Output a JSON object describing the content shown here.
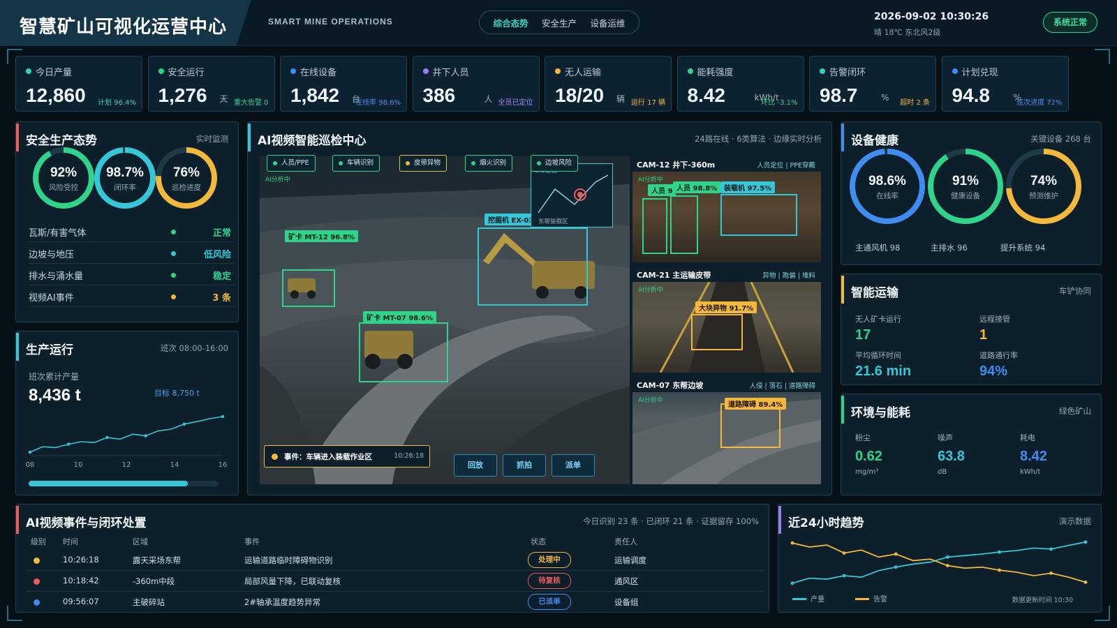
{
  "header": {
    "title": "智慧矿山可视化运营中心",
    "subtitle": "SMART MINE OPERATIONS",
    "tabs": [
      "综合态势",
      "安全生产",
      "设备运维"
    ],
    "datetime": "2026-09-02  10:30:26",
    "weather": "晴 18℃ 东北风2级",
    "status": "系统正常"
  },
  "kpis": [
    {
      "label": "今日产量",
      "value": "12,860",
      "unit": "",
      "note": "计划 96.4%",
      "color": "#33d1c4",
      "note_color": "#33d1c4"
    },
    {
      "label": "安全运行",
      "value": "1,276",
      "unit": "天",
      "note": "重大告警 0",
      "color": "#2fd48b",
      "note_color": "#2fd48b"
    },
    {
      "label": "在线设备",
      "value": "1,842",
      "unit": "台",
      "note": "在线率 98.6%",
      "color": "#3f8df0",
      "note_color": "#3f8df0"
    },
    {
      "label": "井下人员",
      "value": "386",
      "unit": "人",
      "note": "全员已定位",
      "color": "#9a7ef0",
      "note_color": "#a78bff"
    },
    {
      "label": "无人运输",
      "value": "18/20",
      "unit": "辆",
      "note": "运行 17 辆",
      "color": "#f5b93a",
      "note_color": "#f5b93a"
    },
    {
      "label": "能耗强度",
      "value": "8.42",
      "unit": "kWh/t",
      "note": "环比 -3.1%",
      "color": "#2fd48b",
      "note_color": "#2fd48b"
    },
    {
      "label": "告警闭环",
      "value": "98.7",
      "unit": "%",
      "note": "超时 2 条",
      "color": "#33d1c4",
      "note_color": "#f5b93a"
    },
    {
      "label": "计划兑现",
      "value": "94.8",
      "unit": "%",
      "note": "班次进度 72%",
      "color": "#3f8df0",
      "note_color": "#3f8df0"
    }
  ],
  "safety": {
    "title": "安全生产态势",
    "note": "实时监测",
    "rings": [
      {
        "pct": "92%",
        "cap": "风险受控",
        "value": 0.92,
        "color": "#2fd48b"
      },
      {
        "pct": "98.7%",
        "cap": "闭环率",
        "value": 0.987,
        "color": "#33c7d8"
      },
      {
        "pct": "76%",
        "cap": "巡检进度",
        "value": 0.76,
        "color": "#f5b93a"
      }
    ],
    "rows": [
      {
        "name": "瓦斯/有害气体",
        "status": "正常",
        "color": "#2fd48b"
      },
      {
        "name": "边坡与地压",
        "status": "低风险",
        "color": "#33c7d8"
      },
      {
        "name": "排水与涌水量",
        "status": "稳定",
        "color": "#2fd48b"
      },
      {
        "name": "视频AI事件",
        "status": "3 条",
        "color": "#f5b93a"
      }
    ]
  },
  "production": {
    "title": "生产运行",
    "note": "班次 08:00-16:00",
    "cum_label": "班次累计产量",
    "cum_value": "8,436 t",
    "target": "目标 8,750 t",
    "x_ticks": [
      "08",
      "10",
      "12",
      "14",
      "16"
    ],
    "trend": [
      0.05,
      0.18,
      0.16,
      0.24,
      0.3,
      0.28,
      0.4,
      0.36,
      0.48,
      0.44,
      0.56,
      0.6,
      0.72,
      0.78,
      0.85,
      0.9
    ],
    "progress": 0.84
  },
  "video": {
    "title": "AI视频智能巡检中心",
    "note": "24路在线 · 6类算法 · 边缘实时分析",
    "filters": [
      {
        "label": "人员/PPE",
        "color": "#2fd48b"
      },
      {
        "label": "车辆识别",
        "color": "#2fd48b"
      },
      {
        "label": "皮带异物",
        "color": "#f5b93a"
      },
      {
        "label": "烟火识别",
        "color": "#2fd48b"
      },
      {
        "label": "边坡风险",
        "color": "#2fd48b"
      }
    ],
    "main_tags": [
      {
        "text": "矿卡 MT-12  96.8%"
      },
      {
        "text": "挖掘机 EX-03"
      },
      {
        "text": "矿卡 MT-07  98.6%"
      }
    ],
    "ai_label": "AI分析中",
    "gis_label": "GIS定位",
    "gis_area": "东帮装载区",
    "event_text": "事件：车辆进入装载作业区",
    "event_time": "10:26:18",
    "controls": [
      "回放",
      "抓拍",
      "派单"
    ],
    "side": [
      {
        "title": "CAM-12  井下-360m",
        "note": "人员定位 | PPE穿戴",
        "tags": [
          "人员 98.8%",
          "装载机 97.5%",
          "人员 9"
        ]
      },
      {
        "title": "CAM-21  主运输皮带",
        "note": "异物 | 跑偏 | 堆料",
        "tags": [
          "大块异物  91.7%"
        ]
      },
      {
        "title": "CAM-07  东帮边坡",
        "note": "人侵 | 落石 | 道路障碍",
        "tags": [
          "道路障碍  89.4%"
        ]
      }
    ]
  },
  "health": {
    "title": "设备健康",
    "note": "关键设备 268 台",
    "rings": [
      {
        "pct": "98.6%",
        "cap": "在线率",
        "value": 0.986,
        "color": "#3f8df0"
      },
      {
        "pct": "91%",
        "cap": "健康设备",
        "value": 0.91,
        "color": "#2fd48b"
      },
      {
        "pct": "74%",
        "cap": "预测维护",
        "value": 0.74,
        "color": "#f5b93a"
      }
    ],
    "items": [
      "主通风机  98",
      "主排水  96",
      "提升系统  94"
    ]
  },
  "transport": {
    "title": "智能运输",
    "note": "车铲协同",
    "m1_label": "无人矿卡运行",
    "m1_value": "17",
    "m2_label": "远程接管",
    "m2_value": "1",
    "m3_label": "平均循环时间",
    "m3_value": "21.6 min",
    "m4_label": "道路通行率",
    "m4_value": "94%"
  },
  "env": {
    "title": "环境与能耗",
    "note": "绿色矿山",
    "metrics": [
      {
        "label": "粉尘",
        "value": "0.62",
        "unit": "mg/m³",
        "color": "#2fd48b"
      },
      {
        "label": "噪声",
        "value": "63.8",
        "unit": "dB",
        "color": "#33c7d8"
      },
      {
        "label": "耗电",
        "value": "8.42",
        "unit": "kWh/t",
        "color": "#3f8df0"
      }
    ]
  },
  "events": {
    "title": "AI视频事件与闭环处置",
    "note": "今日识别 23 条 · 已闭环 21 条 · 证据留存 100%",
    "headers": [
      "级别",
      "时间",
      "区域",
      "事件",
      "状态",
      "责任人"
    ],
    "rows": [
      {
        "level_color": "#f5b93a",
        "time": "10:26:18",
        "area": "露天采场东帮",
        "event": "运输道路临时障碍物识别",
        "status": "处理中",
        "status_color": "#f5b93a",
        "owner": "运输调度"
      },
      {
        "level_color": "#ef5a5a",
        "time": "10:18:42",
        "area": "-360m中段",
        "event": "局部风量下降，已联动复核",
        "status": "待复核",
        "status_color": "#ef5a5a",
        "owner": "通风区"
      },
      {
        "level_color": "#3f8df0",
        "time": "09:56:07",
        "area": "主破碎站",
        "event": "2#轴承温度趋势异常",
        "status": "已派单",
        "status_color": "#3f8df0",
        "owner": "设备组"
      }
    ]
  },
  "trend24": {
    "title": "近24小时趋势",
    "note": "演示数据",
    "legend": [
      "产量",
      "告警"
    ],
    "footer": "数据更新时间 10:30"
  },
  "chart_data": {
    "type": "line",
    "title": "近24小时趋势",
    "series": [
      {
        "name": "产量",
        "color": "#33c7d8",
        "values": [
          0.1,
          0.2,
          0.18,
          0.25,
          0.22,
          0.35,
          0.42,
          0.48,
          0.52,
          0.62,
          0.65,
          0.68,
          0.72,
          0.75,
          0.8,
          0.78,
          0.85,
          0.92
        ]
      },
      {
        "name": "告警",
        "color": "#f5b93a",
        "values": [
          0.9,
          0.82,
          0.86,
          0.7,
          0.76,
          0.62,
          0.68,
          0.55,
          0.58,
          0.45,
          0.4,
          0.42,
          0.36,
          0.32,
          0.25,
          0.3,
          0.22,
          0.12
        ]
      }
    ]
  }
}
